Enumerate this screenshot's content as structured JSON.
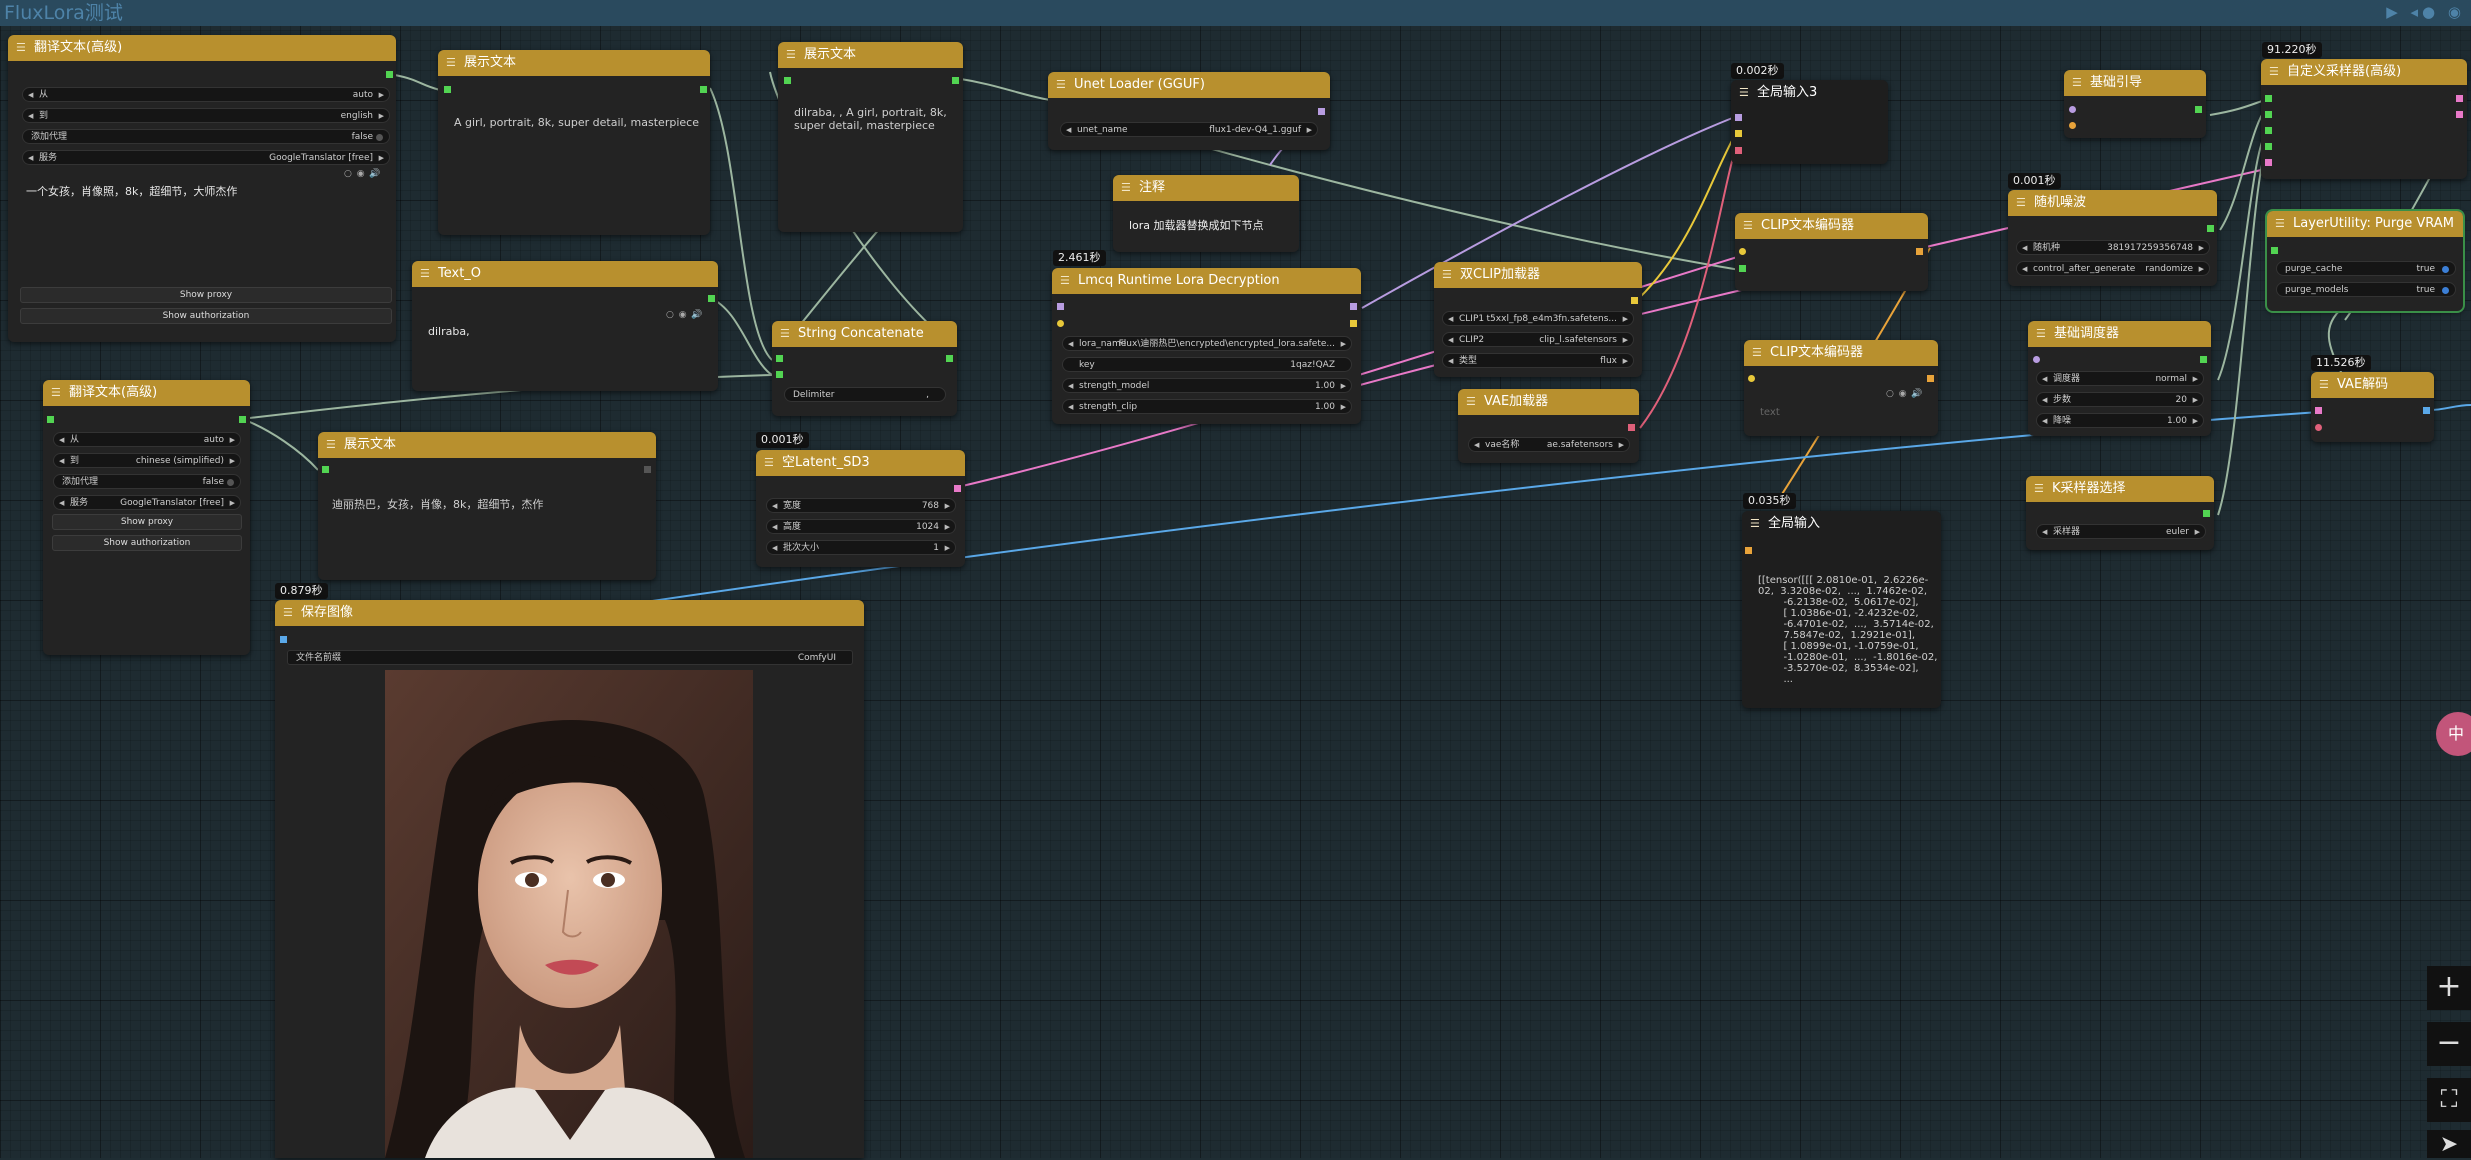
{
  "app": {
    "title": "FluxLora测试",
    "controls": "▶ ◂● ◉"
  },
  "timers": {
    "t_lmcq": "2.461秒",
    "t_latent": "0.001秒",
    "t_save": "0.879秒",
    "t_global3": "0.002秒",
    "t_global": "0.035秒",
    "t_random": "0.001秒",
    "t_sampler": "91.220秒",
    "t_vae": "11.526秒"
  },
  "translate1": {
    "title": "翻译文本(高级)",
    "from_label": "从",
    "from_value": "auto",
    "to_label": "到",
    "to_value": "english",
    "proxy_label": "添加代理",
    "proxy_value": "false",
    "service_label": "服务",
    "service_value": "GoogleTranslator [free]",
    "text": "一个女孩，肖像照，8k，超细节，大师杰作",
    "show_proxy": "Show proxy",
    "show_auth": "Show authorization"
  },
  "show_text1": {
    "title": "展示文本",
    "text": "A girl, portrait, 8k, super detail, masterpiece"
  },
  "show_text2": {
    "title": "展示文本",
    "text": "dilraba, , A girl, portrait, 8k,\nsuper detail, masterpiece"
  },
  "text_o": {
    "title": "Text_O",
    "text": "dilraba,"
  },
  "concat": {
    "title": "String Concatenate",
    "delim_label": "Delimiter",
    "delim_value": ","
  },
  "translate2": {
    "title": "翻译文本(高级)",
    "from_label": "从",
    "from_value": "auto",
    "to_label": "到",
    "to_value": "chinese (simplified)",
    "proxy_label": "添加代理",
    "proxy_value": "false",
    "service_label": "服务",
    "service_value": "GoogleTranslator [free]",
    "show_proxy": "Show proxy",
    "show_auth": "Show authorization"
  },
  "show_text3": {
    "title": "展示文本",
    "text": "迪丽热巴，女孩，肖像，8k，超细节，杰作"
  },
  "latent": {
    "title": "空Latent_SD3",
    "w_label": "宽度",
    "w_value": "768",
    "h_label": "高度",
    "h_value": "1024",
    "b_label": "批次大小",
    "b_value": "1"
  },
  "save": {
    "title": "保存图像",
    "prefix_label": "文件名前缀",
    "prefix_value": "ComfyUI"
  },
  "unet": {
    "title": "Unet Loader (GGUF)",
    "label": "unet_name",
    "value": "flux1-dev-Q4_1.gguf"
  },
  "note": {
    "title": "注释",
    "text": "lora 加载器替换成如下节点"
  },
  "lmcq": {
    "title": "Lmcq Runtime Lora Decryption",
    "lora_label": "lora_name",
    "lora_value": "Flux\\迪丽热巴\\encrypted\\encrypted_lora.safete...",
    "key_label": "key",
    "key_value": "1qaz!QAZ",
    "sm_label": "strength_model",
    "sm_value": "1.00",
    "sc_label": "strength_clip",
    "sc_value": "1.00"
  },
  "dualclip": {
    "title": "双CLIP加载器",
    "c1_label": "CLIP1",
    "c1_value": "t5xxl_fp8_e4m3fn.safetens...",
    "c2_label": "CLIP2",
    "c2_value": "clip_l.safetensors",
    "type_label": "类型",
    "type_value": "flux"
  },
  "vaeload": {
    "title": "VAE加载器",
    "label": "vae名称",
    "value": "ae.safetensors"
  },
  "global3": {
    "title": "全局输入3"
  },
  "clipenc1": {
    "title": "CLIP文本编码器"
  },
  "clipenc2": {
    "title": "CLIP文本编码器",
    "placeholder": "text"
  },
  "global": {
    "title": "全局输入",
    "text": "[[tensor([[[ 2.0810e-01,  2.6226e-02,  3.3208e-02,  ...,  1.7462e-02,\n        -6.2138e-02,  5.0617e-02],\n        [ 1.0386e-01, -2.4232e-02,\n        -6.4701e-02,  ...,  3.5714e-02,\n        7.5847e-02,  1.2921e-01],\n        [ 1.0899e-01, -1.0759e-01,\n        -1.0280e-01,  ...,  -1.8016e-02,\n        -3.5270e-02,  8.3534e-02],\n        ..."
  },
  "guide": {
    "title": "基础引导"
  },
  "random": {
    "title": "随机噪波",
    "seed_label": "随机种",
    "seed_value": "381917259356748",
    "cag_label": "control_after_generate",
    "cag_value": "randomize"
  },
  "scheduler": {
    "title": "基础调度器",
    "s_label": "调度器",
    "s_value": "normal",
    "st_label": "步数",
    "st_value": "20",
    "d_label": "降噪",
    "d_value": "1.00"
  },
  "ksel": {
    "title": "K采样器选择",
    "label": "采样器",
    "value": "euler"
  },
  "sampler": {
    "title": "自定义采样器(高级)"
  },
  "purge": {
    "title": "LayerUtility: Purge VRAM",
    "pc_label": "purge_cache",
    "pc_value": "true",
    "pm_label": "purge_models",
    "pm_value": "true"
  },
  "vaedec": {
    "title": "VAE解码"
  },
  "side_badge": "中",
  "colors": {
    "header": "#b8902e",
    "link_green": "#9cb6a0",
    "link_pink": "#e879c8",
    "link_blue": "#5aa8e8",
    "link_yellow": "#e8c83a",
    "link_purple": "#b89ce0",
    "link_orange": "#e8a33a",
    "link_red": "#e0607a"
  }
}
